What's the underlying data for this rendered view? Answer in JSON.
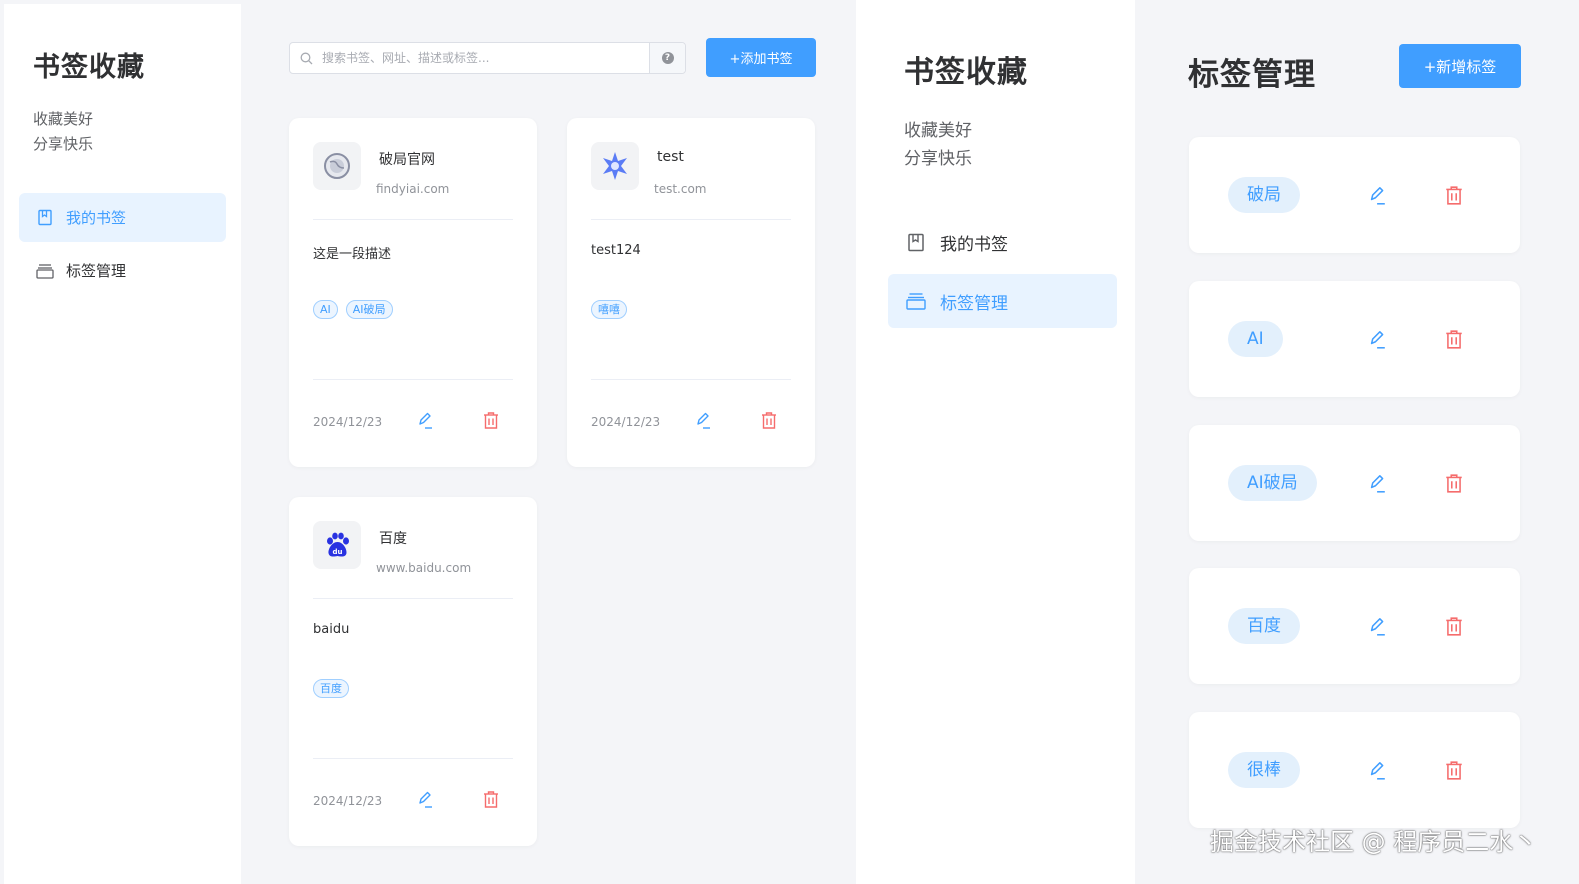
{
  "left": {
    "sidebar": {
      "app_title": "书签收藏",
      "slogan_line1": "收藏美好",
      "slogan_line2": "分享快乐",
      "nav": [
        {
          "label": "我的书签",
          "icon": "bookmark-icon",
          "active": true
        },
        {
          "label": "标签管理",
          "icon": "tag-box-icon",
          "active": false
        }
      ]
    },
    "search": {
      "placeholder": "搜索书签、网址、描述或标签...",
      "help": "?"
    },
    "add_button": "+添加书签",
    "cards": [
      {
        "title": "破局官网",
        "url": "findyiai.com",
        "description": "这是一段描述",
        "tags": [
          "AI",
          "AI破局"
        ],
        "date": "2024/12/23",
        "icon": "globe-icon"
      },
      {
        "title": "test",
        "url": "test.com",
        "description": "test124",
        "tags": [
          "嘻嘻"
        ],
        "date": "2024/12/23",
        "icon": "star-burst-icon"
      },
      {
        "title": "百度",
        "url": "www.baidu.com",
        "description": "baidu",
        "tags": [
          "百度"
        ],
        "date": "2024/12/23",
        "icon": "baidu-paw-icon"
      }
    ]
  },
  "right": {
    "sidebar": {
      "app_title": "书签收藏",
      "slogan_line1": "收藏美好",
      "slogan_line2": "分享快乐",
      "nav": [
        {
          "label": "我的书签",
          "icon": "bookmark-icon",
          "active": false
        },
        {
          "label": "标签管理",
          "icon": "tag-box-icon",
          "active": true
        }
      ]
    },
    "page_title": "标签管理",
    "new_tag_button": "+新增标签",
    "tags": [
      {
        "name": "破局"
      },
      {
        "name": "AI"
      },
      {
        "name": "AI破局"
      },
      {
        "name": "百度"
      },
      {
        "name": "很棒"
      }
    ]
  },
  "watermark": "掘金技术社区 @ 程序员二水丶",
  "colors": {
    "primary": "#409eff",
    "danger": "#f56c6c",
    "active_bg": "#e8f3ff",
    "page_bg": "#f4f5f8"
  }
}
